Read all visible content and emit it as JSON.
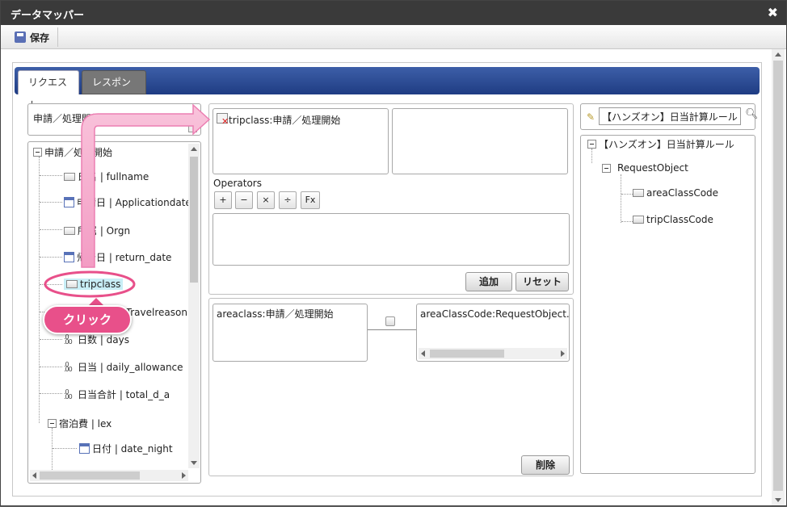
{
  "window": {
    "title": "データマッパー",
    "close_glyph": "✖"
  },
  "toolbar": {
    "save_label": "保存"
  },
  "tabs": [
    {
      "label": "リクエスト"
    },
    {
      "label": "レスポンス"
    }
  ],
  "left_panel": {
    "header_label": "申請／処理開始",
    "tree": {
      "root": "申請／処理開始",
      "items": [
        {
          "label": "氏名 | fullname",
          "icon": "field"
        },
        {
          "label": "申請日 | Applicationdate",
          "icon": "date"
        },
        {
          "label": "所属 | Orgn",
          "icon": "field"
        },
        {
          "label": "帰着日 | return_date",
          "icon": "date"
        },
        {
          "label": "tripclass",
          "icon": "field"
        },
        {
          "label": "出張目的 | Travelreason",
          "icon": "field"
        },
        {
          "label": "日数 | days",
          "icon": "number"
        },
        {
          "label": "日当 | daily_allowance",
          "icon": "number"
        },
        {
          "label": "日当合計 | total_d_a",
          "icon": "number"
        }
      ],
      "group": "宿泊費 | lex",
      "group_items": [
        {
          "label": "日付 | date_night",
          "icon": "date"
        }
      ]
    }
  },
  "callout": {
    "label": "クリック",
    "color": "#e8508a"
  },
  "mapping": {
    "source_item": "tripclass:申請／処理開始",
    "operators_label": "Operators",
    "operators": [
      "+",
      "−",
      "×",
      "÷",
      "Fx"
    ],
    "add_button": "追加",
    "reset_button": "リセット",
    "rule_source": "areaclass:申請／処理開始",
    "rule_target": "areaClassCode:RequestObject.【ハ",
    "delete_button": "削除"
  },
  "right_panel": {
    "search_value": "【ハンズオン】日当計算ルール",
    "tree": {
      "root": "【ハンズオン】日当計算ルール",
      "child": "RequestObject",
      "leaves": [
        "areaClassCode",
        "tripClassCode"
      ]
    }
  },
  "colors": {
    "accent": "#2a4a94",
    "highlight": "#c8eef6",
    "callout": "#e8508a"
  }
}
